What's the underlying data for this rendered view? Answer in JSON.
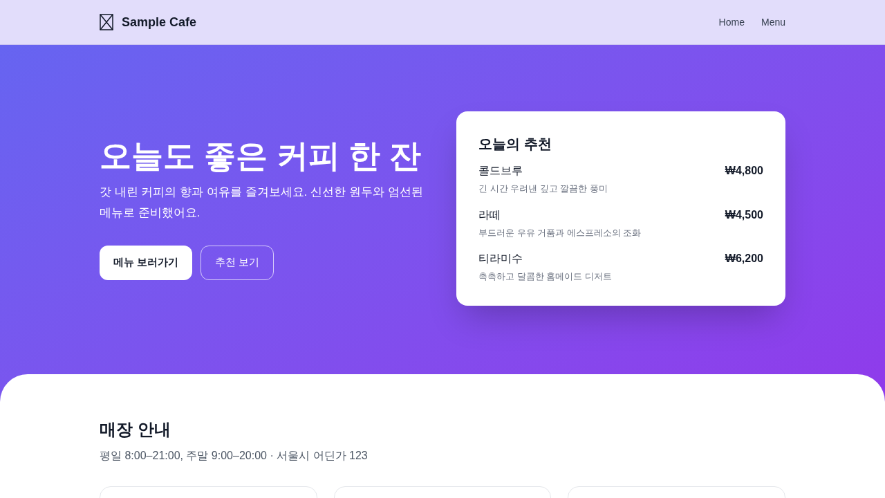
{
  "header": {
    "brand": "Sample Cafe",
    "nav": [
      {
        "label": "Home"
      },
      {
        "label": "Menu"
      }
    ]
  },
  "hero": {
    "title": "오늘도 좋은 커피 한 잔",
    "subtitle": "갓 내린 커피의 향과 여유를 즐겨보세요. 신선한 원두와 엄선된 메뉴로 준비했어요.",
    "buttons": [
      {
        "label": "메뉴 보러가기",
        "kind": "primary"
      },
      {
        "label": "추천 보기",
        "kind": "outline"
      }
    ]
  },
  "recommend": {
    "title": "오늘의 추천",
    "items": [
      {
        "name": "콜드브루",
        "price": "₩4,800",
        "description": "긴 시간 우려낸 깊고 깔끔한 풍미"
      },
      {
        "name": "라떼",
        "price": "₩4,500",
        "description": "부드러운 우유 거품과 에스프레소의 조화"
      },
      {
        "name": "티라미수",
        "price": "₩6,200",
        "description": "촉촉하고 달콤한 홈메이드 디저트"
      }
    ]
  },
  "store_info": {
    "title": "매장 안내",
    "details": "평일 8:00–21:00, 주말 9:00–20:00 · 서울시 어딘가 123"
  }
}
